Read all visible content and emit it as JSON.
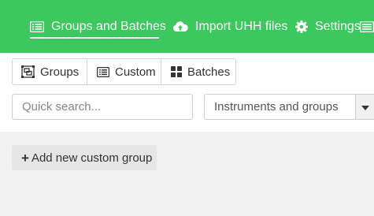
{
  "nav": {
    "groups_label": "Groups and Batches",
    "import_label": "Import UHH files",
    "settings_label": "Settings",
    "groups_icon": "list-icon",
    "import_icon": "cloud-upload-icon",
    "settings_icon": "gear-icon"
  },
  "tabs": {
    "groups": "Groups",
    "custom": "Custom",
    "batches": "Batches"
  },
  "filters": {
    "search_placeholder": "Quick search...",
    "select_value": "Instruments and groups"
  },
  "actions": {
    "add_plus": "+",
    "add_label": "Add new custom group"
  },
  "colors": {
    "accent": "#3cc85e"
  }
}
